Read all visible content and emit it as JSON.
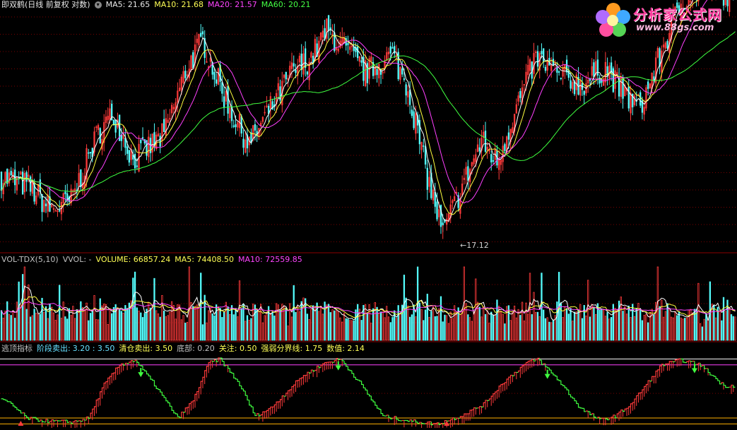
{
  "legend_main": {
    "title": "即双鹤(日线 前复权 对数)",
    "ma5": "MA5: 21.65",
    "ma10": "MA10: 21.68",
    "ma20": "MA20: 21.57",
    "ma60": "MA60: 20.21"
  },
  "legend_vol": {
    "title": "VOL-TDX(5,10)",
    "vvol": "VVOL: -",
    "volume": "VOLUME: 66857.24",
    "ma5": "MA5: 74408.50",
    "ma10": "MA10: 72559.85"
  },
  "legend_ind": {
    "title": "逃顶指标",
    "stage_sell_label": "阶段卖出:",
    "stage_sell_value": "3.20 : 3.50",
    "clear_sell": "清仓卖出: 3.50",
    "bottom": "底部: 0.20",
    "watch": "关注: 0.50",
    "strength_line": "强弱分界线: 1.75",
    "value": "数值: 2.14"
  },
  "logo": {
    "text": "分析家公式网",
    "url": "www.88gs.com"
  },
  "low_label": "←17.12",
  "colors": {
    "up": "#ff3b3b",
    "down": "#54fcfc",
    "ma5": "#ffffff",
    "ma10": "#ffff40",
    "ma20": "#ff40ff",
    "ma60": "#40ff40",
    "grid": "#7a0000",
    "ind_up": "#ff3b3b",
    "ind_down": "#40ff40",
    "ref_top": "#ff40ff",
    "ref_bottom": "#ffb000"
  },
  "chart_data": [
    {
      "type": "candlestick",
      "name": "price",
      "low_marker": 17.12,
      "series": [
        {
          "name": "MA5",
          "value": 21.65
        },
        {
          "name": "MA10",
          "value": 21.68
        },
        {
          "name": "MA20",
          "value": 21.57
        },
        {
          "name": "MA60",
          "value": 20.21
        }
      ],
      "ylim": [
        16.8,
        25.0
      ],
      "anchors": [
        [
          0,
          19.2
        ],
        [
          14,
          18.9
        ],
        [
          26,
          18.1
        ],
        [
          36,
          18.4
        ],
        [
          50,
          20.7
        ],
        [
          58,
          21.3
        ],
        [
          68,
          19.8
        ],
        [
          84,
          20.6
        ],
        [
          96,
          22.9
        ],
        [
          104,
          23.8
        ],
        [
          112,
          22.4
        ],
        [
          120,
          21.2
        ],
        [
          128,
          20.3
        ],
        [
          140,
          21.6
        ],
        [
          150,
          22.7
        ],
        [
          160,
          23.2
        ],
        [
          168,
          24.1
        ],
        [
          176,
          23.6
        ],
        [
          188,
          22.7
        ],
        [
          202,
          23.3
        ],
        [
          210,
          22.2
        ],
        [
          220,
          19.2
        ],
        [
          228,
          17.3
        ],
        [
          238,
          18.9
        ],
        [
          248,
          20.4
        ],
        [
          256,
          19.7
        ],
        [
          264,
          21.2
        ],
        [
          276,
          23.2
        ],
        [
          288,
          22.6
        ],
        [
          300,
          22.3
        ],
        [
          312,
          22.9
        ],
        [
          320,
          22.1
        ],
        [
          330,
          21.5
        ],
        [
          342,
          23.6
        ],
        [
          352,
          25.2
        ],
        [
          364,
          25.6
        ],
        [
          378,
          25.3
        ]
      ]
    },
    {
      "type": "bar",
      "name": "volume",
      "series": [
        {
          "name": "VOLUME",
          "value": 66857.24
        },
        {
          "name": "MA5",
          "value": 74408.5
        },
        {
          "name": "MA10",
          "value": 72559.85
        }
      ]
    },
    {
      "type": "line",
      "name": "逃顶指标",
      "ylim": [
        0,
        3.8
      ],
      "reference_lines": [
        {
          "name": "阶段卖出",
          "value": 3.2
        },
        {
          "name": "清仓卖出",
          "value": 3.5
        },
        {
          "name": "底部",
          "value": 0.2
        },
        {
          "name": "关注",
          "value": 0.5
        },
        {
          "name": "强弱分界线",
          "value": 1.75
        }
      ],
      "last_value": 2.14,
      "anchors": [
        [
          0,
          1.5
        ],
        [
          6,
          1.2
        ],
        [
          14,
          0.5
        ],
        [
          24,
          0.35
        ],
        [
          38,
          0.3
        ],
        [
          46,
          0.5
        ],
        [
          54,
          2.2
        ],
        [
          62,
          3.2
        ],
        [
          70,
          3.45
        ],
        [
          80,
          2.2
        ],
        [
          92,
          0.5
        ],
        [
          100,
          1.4
        ],
        [
          108,
          3.3
        ],
        [
          114,
          3.5
        ],
        [
          124,
          2.2
        ],
        [
          132,
          0.6
        ],
        [
          140,
          1.0
        ],
        [
          148,
          1.8
        ],
        [
          156,
          2.6
        ],
        [
          168,
          3.3
        ],
        [
          176,
          3.5
        ],
        [
          186,
          2.3
        ],
        [
          198,
          0.6
        ],
        [
          212,
          0.35
        ],
        [
          226,
          0.2
        ],
        [
          238,
          0.6
        ],
        [
          250,
          1.2
        ],
        [
          260,
          2.3
        ],
        [
          272,
          3.3
        ],
        [
          278,
          3.5
        ],
        [
          288,
          2.5
        ],
        [
          300,
          1.0
        ],
        [
          310,
          0.4
        ],
        [
          318,
          0.6
        ],
        [
          326,
          1.2
        ],
        [
          334,
          2.2
        ],
        [
          342,
          3.2
        ],
        [
          352,
          3.45
        ],
        [
          362,
          3.2
        ],
        [
          374,
          2.14
        ]
      ],
      "sell_signals": [
        72,
        174,
        282,
        358
      ],
      "buy_signals": [
        10,
        230
      ]
    }
  ]
}
